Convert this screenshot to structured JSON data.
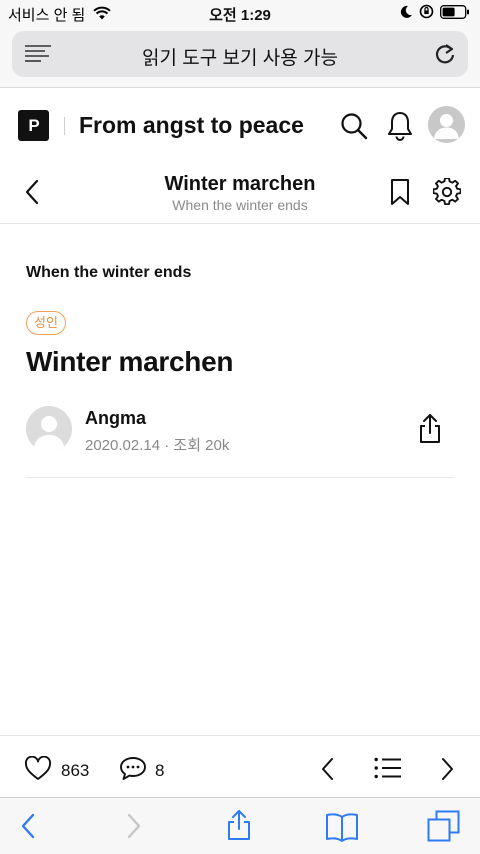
{
  "status_bar": {
    "carrier": "서비스 안 됨",
    "time": "오전 1:29"
  },
  "browser": {
    "url_label": "읽기 도구 보기 사용 가능",
    "icons": [
      "reader-mode-icon",
      "reload-icon"
    ]
  },
  "site": {
    "logo_text": "P",
    "title": "From angst to peace"
  },
  "series_nav": {
    "title": "Winter marchen",
    "subtitle": "When the winter ends"
  },
  "post": {
    "series_label": "When the winter ends",
    "age_badge": "성인",
    "title": "Winter marchen",
    "author": "Angma",
    "meta": "2020.02.14 · 조회 20k"
  },
  "action_bar": {
    "likes": "863",
    "comments": "8"
  },
  "colors": {
    "accent_orange": "#ee8f3c",
    "safari_blue": "#2f7bf5"
  }
}
